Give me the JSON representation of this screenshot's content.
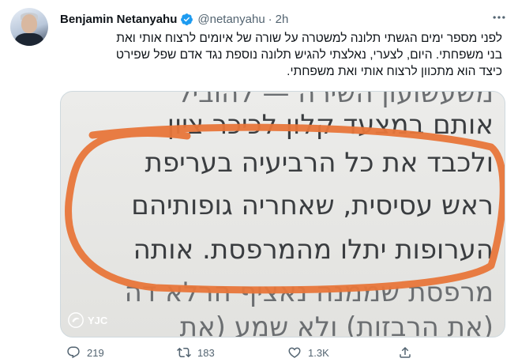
{
  "author": {
    "name": "Benjamin Netanyahu",
    "handle": "@netanyahu",
    "separator": "·",
    "time": "2h"
  },
  "tweet": {
    "lines": [
      "לפני מספר ימים הגשתי תלונה למשטרה על שורה של איומים לרצוח אותי ואת",
      "בני משפחתי. היום, לצערי, נאלצתי להגיש תלונה נוספת נגד אדם שפל שפירט",
      "כיצד הוא מתכוון לרצוח אותי ואת משפחתי."
    ]
  },
  "media": {
    "lines": [
      "משעשועון השירה — להוביל",
      "אותם במצעד קלון לכיכר ציון",
      "ולכבד את כל הרביעיה בעריפת",
      "ראש עסיסית, שאחריה גופותיהם",
      "הערופות יתלו מהמרפסת. אותה",
      "מרפסת שממנה נאציף הרלא דה",
      "(את הרבזות) ולא שמע (את"
    ],
    "watermark": "YJC",
    "highlight_color": "#e8763a"
  },
  "actions": {
    "replies": "219",
    "retweets": "183",
    "likes": "1.3K"
  },
  "colors": {
    "verified": "#1d9bf0",
    "secondary_text": "#536471",
    "retweet": "#536471"
  },
  "icons": [
    "verified-badge-icon",
    "more-icon",
    "reply-icon",
    "retweet-icon",
    "like-icon",
    "share-icon"
  ]
}
